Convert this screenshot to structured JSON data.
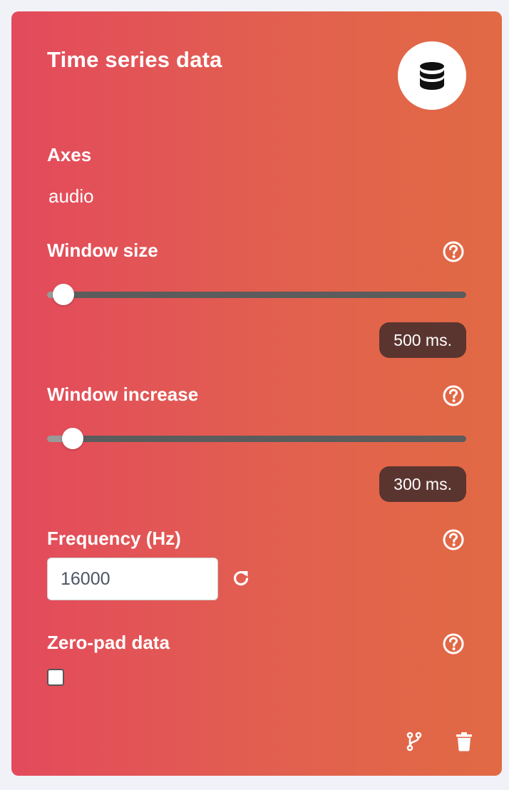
{
  "card": {
    "title": "Time series data",
    "icon": "database-icon",
    "gradient_start": "#e34a5c",
    "gradient_end": "#e16a44"
  },
  "axes": {
    "label": "Axes",
    "value": "audio"
  },
  "window_size": {
    "label": "Window size",
    "value_display": "500 ms.",
    "slider_fraction": 0.015
  },
  "window_increase": {
    "label": "Window increase",
    "value_display": "300 ms.",
    "slider_fraction": 0.037
  },
  "frequency": {
    "label": "Frequency (Hz)",
    "value": "16000"
  },
  "zero_pad": {
    "label": "Zero-pad data",
    "checked": false
  },
  "footer": {
    "branch_icon": "branch-icon",
    "delete_icon": "trash-icon"
  },
  "colors": {
    "pill_bg": "#5a3530",
    "track": "#5c5c5c"
  }
}
